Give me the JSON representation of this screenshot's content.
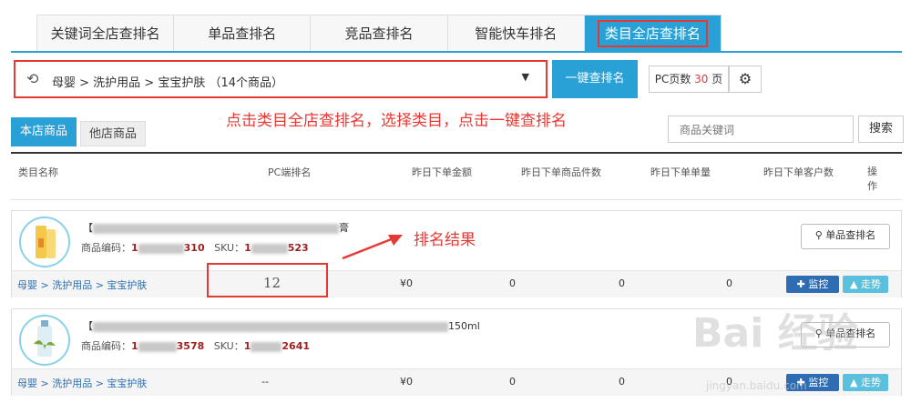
{
  "tabs": [
    "关键词全店查排名",
    "单品查排名",
    "竞品查排名",
    "智能快车排名",
    "类目全店查排名"
  ],
  "category_select": {
    "value": "母婴 > 洗护用品 > 宝宝护肤 （14个商品）"
  },
  "buttons": {
    "one_click": "一键查排名",
    "search": "搜索"
  },
  "pc_pages": {
    "prefix": "PC页数",
    "num": "30",
    "suffix": "页"
  },
  "annotation_top": "点击类目全店查排名，选择类目，点击一键查排名",
  "annotation_result": "排名结果",
  "subtabs": {
    "own": "本店商品",
    "other": "他店商品"
  },
  "keyword_input": {
    "placeholder": "商品关键词"
  },
  "table_header": {
    "cat": "类目名称",
    "pc": "PC端排名",
    "amt": "昨日下单金额",
    "items": "昨日下单商品件数",
    "orders": "昨日下单单量",
    "customers": "昨日下单客户数",
    "op": "操作"
  },
  "products": [
    {
      "title_prefix": "【",
      "title_suffix": "膏",
      "code_label": "商品编码：",
      "code_start": "1",
      "code_end": "310",
      "sku_label": "SKU：",
      "sku_start": "1",
      "sku_end": "523",
      "rank_button": "单品查排名",
      "crumb": "母婴 > 洗护用品 > 宝宝护肤",
      "pc": "12",
      "amt": "¥0",
      "items": "0",
      "orders": "0",
      "customers": "0",
      "monitor": "监控",
      "trend": "走势"
    },
    {
      "title_prefix": "【",
      "title_suffix": "150ml",
      "code_label": "商品编码：",
      "code_start": "1",
      "code_end": "3578",
      "sku_label": "SKU：",
      "sku_start": "1",
      "sku_end": "2641",
      "rank_button": "单品查排名",
      "crumb": "母婴 > 洗护用品 > 宝宝护肤",
      "pc": "--",
      "amt": "¥0",
      "items": "0",
      "orders": "0",
      "customers": "0",
      "monitor": "监控",
      "trend": "走势"
    }
  ],
  "watermark": {
    "logo": "Bai 经验",
    "url": "jingyan.baidu.com"
  }
}
